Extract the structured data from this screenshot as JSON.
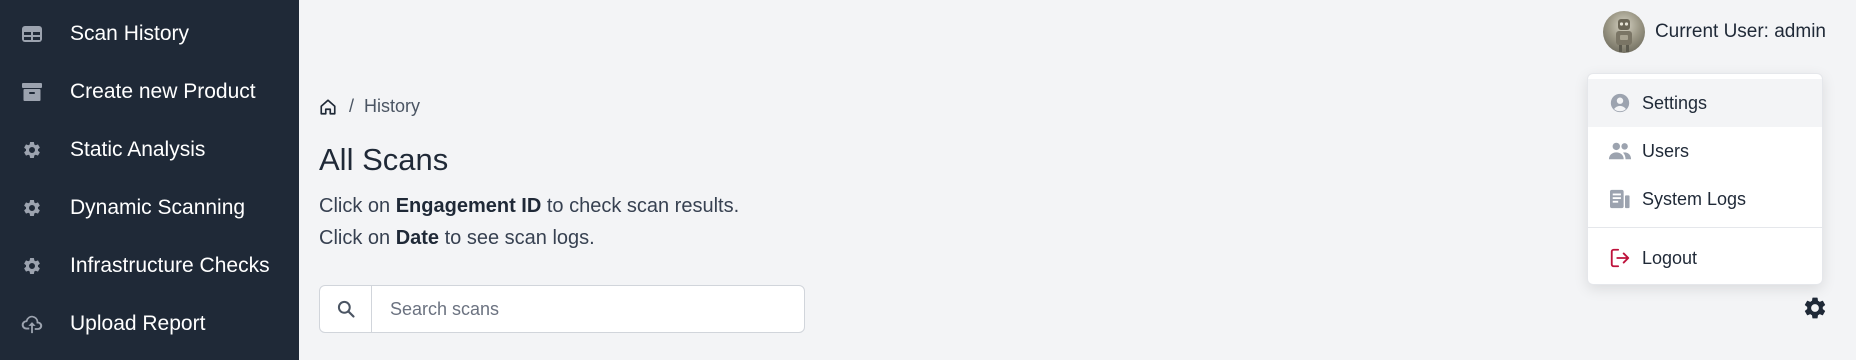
{
  "sidebar": {
    "items": [
      {
        "label": "Scan History",
        "icon": "table-icon"
      },
      {
        "label": "Create new Product",
        "icon": "archive-icon"
      },
      {
        "label": "Static Analysis",
        "icon": "gear-icon"
      },
      {
        "label": "Dynamic Scanning",
        "icon": "gear-icon"
      },
      {
        "label": "Infrastructure Checks",
        "icon": "gear-icon"
      },
      {
        "label": "Upload Report",
        "icon": "cloud-upload-icon"
      }
    ]
  },
  "breadcrumb": {
    "separator": "/",
    "current": "History"
  },
  "main": {
    "title": "All Scans",
    "instructions": [
      {
        "prefix": "Click on ",
        "bold": "Engagement ID",
        "suffix": " to check scan results."
      },
      {
        "prefix": "Click on ",
        "bold": "Date",
        "suffix": " to see scan logs."
      }
    ]
  },
  "search": {
    "placeholder": "Search scans",
    "value": ""
  },
  "user": {
    "label": "Current User: admin"
  },
  "menu": {
    "items": [
      {
        "label": "Settings",
        "icon": "user-circle-icon",
        "active": true
      },
      {
        "label": "Users",
        "icon": "users-icon"
      },
      {
        "label": "System Logs",
        "icon": "logs-icon"
      },
      {
        "label": "Logout",
        "icon": "logout-icon"
      }
    ]
  },
  "colors": {
    "sidebar_bg": "#1f2937",
    "page_bg": "#f3f4f6",
    "logout_icon": "#be123c",
    "menu_icon": "#9ca3af"
  }
}
